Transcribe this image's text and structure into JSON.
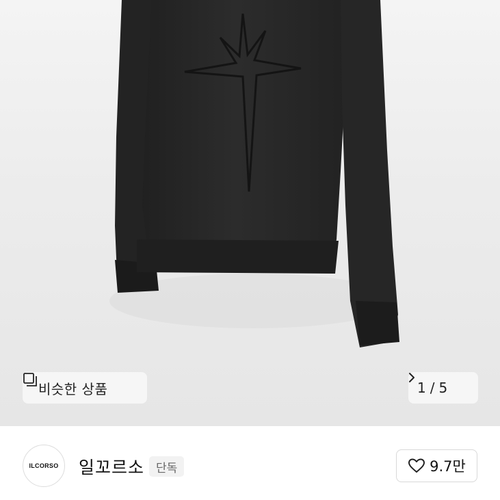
{
  "product_image": {
    "similar_button": {
      "label": "비슷한 상품",
      "icon": "similar-items-icon"
    },
    "counter": {
      "current": "1",
      "separator": "/",
      "total": "5",
      "icon": "chevron-right-icon"
    }
  },
  "seller": {
    "logo_text": "ILCORSO",
    "name": "일꼬르소",
    "badge": "단독"
  },
  "like": {
    "icon": "heart-icon",
    "count": "9.7만"
  },
  "colors": {
    "garment": "#262626",
    "background": "#eeeeee",
    "pill_background": "#f6f6f6",
    "text": "#111111",
    "badge_background": "#f2f2f2"
  }
}
